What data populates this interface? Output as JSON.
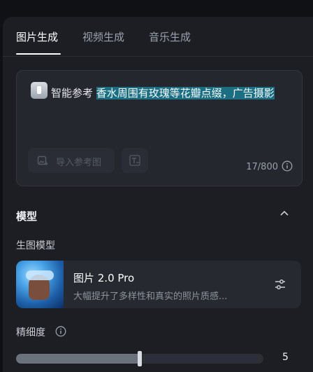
{
  "tabs": [
    {
      "label": "图片生成",
      "active": true
    },
    {
      "label": "视频生成",
      "active": false
    },
    {
      "label": "音乐生成",
      "active": false
    }
  ],
  "prompt": {
    "ref_label": "智能参考",
    "text": "香水周围有玫瑰等花瓣点缀，广告摄影",
    "import_button": "导入参考图",
    "text_button_icon": "text-icon",
    "counter": "17/800"
  },
  "model_section": {
    "title": "模型",
    "sub_label": "生图模型",
    "model": {
      "name": "图片 2.0 Pro",
      "description": "大幅提升了多样性和真实的照片质感..."
    }
  },
  "fineness": {
    "label": "精细度",
    "value": "5",
    "fraction": 0.5
  },
  "colors": {
    "highlight": "#1c6f82",
    "panel": "#1c1e24"
  }
}
